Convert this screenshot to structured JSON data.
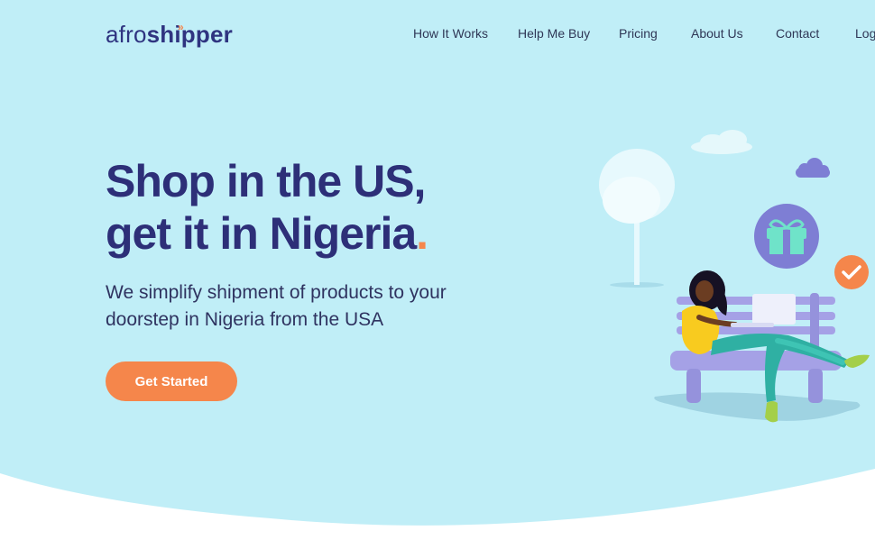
{
  "brand": {
    "logo_light": "afro",
    "logo_bold": "shipper",
    "arrows": "»",
    "colors": {
      "navy": "#2d2f78",
      "orange": "#f5864b",
      "sky": "#c0eef7"
    }
  },
  "nav": {
    "items": [
      "How It Works",
      "Help Me Buy",
      "Pricing",
      "About Us",
      "Contact",
      "Log"
    ]
  },
  "hero": {
    "headline_line1": "Shop in the US,",
    "headline_line2": "get it in Nigeria",
    "headline_dot": ".",
    "subheadline": "We simplify shipment of products to your doorstep in Nigeria from the USA",
    "cta_label": "Get Started"
  },
  "illustration": {
    "icons": [
      "cloud-icon",
      "gift-icon",
      "check-icon",
      "tree-icon",
      "laptop-icon",
      "bench-icon"
    ]
  }
}
